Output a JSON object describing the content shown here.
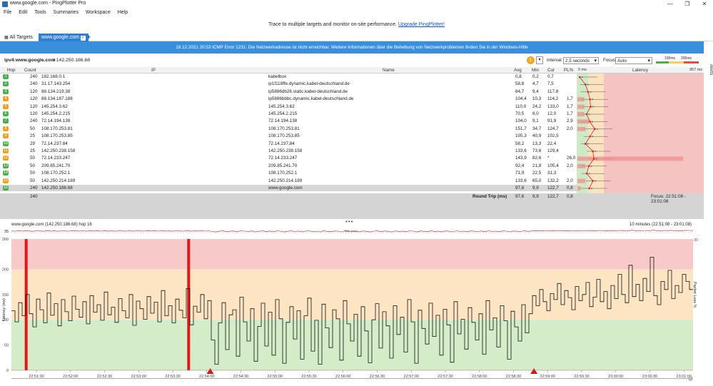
{
  "window": {
    "title": "www.google.com - PingPlotter Pro",
    "min": "—",
    "max": "❐",
    "close": "✕"
  },
  "menu": [
    "File",
    "Edit",
    "Tools",
    "Summaries",
    "Workspace",
    "Help"
  ],
  "banner": {
    "text": "Trace to multiple targets and monitor on-site performance.",
    "link": "Upgrade PingPlotter!"
  },
  "tabs": {
    "all_targets": "All Targets",
    "active": "www.google.com",
    "add": "+"
  },
  "error_bar": "18.12.2021 20:53 ICMP Error 1231: Die Netzwerkadresse ist nicht erreichbar. Weitere Informationen über die Behebung von Netzwerkproblemen finden Sie in der Windows-Hilfe",
  "alerts_label": "Alerts",
  "target": {
    "label": "ipv4:www.google.com",
    "ip": "/ 142.250.186.68"
  },
  "toolbar": {
    "interval_label": "Interval",
    "interval_value": "2,5 seconds",
    "focus_label": "Focus",
    "focus_value": "Auto",
    "scale_100": "100ms",
    "scale_200": "200ms"
  },
  "columns": {
    "hop": "Hop",
    "count": "Count",
    "ip": "IP",
    "name": "Name",
    "avg": "Avg",
    "min": "Min",
    "cur": "Cur",
    "pl": "PL%",
    "zero": "0 ms",
    "latency": "Latency",
    "max": "957 ms"
  },
  "hops": [
    {
      "hop": "1",
      "count": "240",
      "ip": "192.168.0.1",
      "name": "kabelbox",
      "avg": "0,8",
      "min": "0,2",
      "cur": "0,7",
      "pl": "",
      "color": "#4caf50"
    },
    {
      "hop": "2",
      "count": "240",
      "ip": "31.17.143.254",
      "name": "ip1f118ffe.dynamic.kabel-deutschland.de",
      "avg": "58,8",
      "min": "4,7",
      "cur": "7,5",
      "pl": "",
      "color": "#4caf50"
    },
    {
      "hop": "3",
      "count": "120",
      "ip": "88.134.219.38",
      "name": "ip5886db26.static.kabel-deutschland.de",
      "avg": "84,7",
      "min": "9,4",
      "cur": "117,8",
      "pl": "",
      "color": "#4caf50"
    },
    {
      "hop": "4",
      "count": "120",
      "ip": "88.134.187.188",
      "name": "ip5886bbbc.dynamic.kabel-deutschland.de",
      "avg": "104,4",
      "min": "10,3",
      "cur": "114,2",
      "pl": "1,7",
      "color": "#f0a020"
    },
    {
      "hop": "5",
      "count": "120",
      "ip": "145.254.3.62",
      "name": "145.254.3.62",
      "avg": "110,0",
      "min": "24,2",
      "cur": "133,0",
      "pl": "1,7",
      "color": "#f0a020"
    },
    {
      "hop": "6",
      "count": "120",
      "ip": "145.254.2.215",
      "name": "145.254.2.215",
      "avg": "70,5",
      "min": "8,0",
      "cur": "12,0",
      "pl": "1,7",
      "color": "#4caf50"
    },
    {
      "hop": "7",
      "count": "240",
      "ip": "72.14.194.138",
      "name": "72.14.194.138",
      "avg": "104,0",
      "min": "9,1",
      "cur": "91,9",
      "pl": "2,9",
      "color": "#4caf50"
    },
    {
      "hop": "8",
      "count": "50",
      "ip": "108.170.253.81",
      "name": "108.170.253.81",
      "avg": "151,7",
      "min": "34,7",
      "cur": "124,7",
      "pl": "2,0",
      "color": "#f0a020"
    },
    {
      "hop": "9",
      "count": "25",
      "ip": "108.170.253.85",
      "name": "108.170.253.85",
      "avg": "105,3",
      "min": "40,9",
      "cur": "102,5",
      "pl": "",
      "color": "#f0a020"
    },
    {
      "hop": "10",
      "count": "29",
      "ip": "72.14.237.84",
      "name": "72.14.237.84",
      "avg": "58,2",
      "min": "13,3",
      "cur": "22,4",
      "pl": "",
      "color": "#4caf50"
    },
    {
      "hop": "11",
      "count": "25",
      "ip": "142.250.238.158",
      "name": "142.250.238.158",
      "avg": "133,6",
      "min": "73,6",
      "cur": "129,4",
      "pl": "",
      "color": "#f0a020"
    },
    {
      "hop": "12",
      "count": "50",
      "ip": "72.14.233.247",
      "name": "72.14.233.247",
      "avg": "143,9",
      "min": "82,6",
      "cur": "*",
      "pl": "26,0",
      "color": "#f0a020"
    },
    {
      "hop": "13",
      "count": "50",
      "ip": "209.85.241.70",
      "name": "209.85.241.70",
      "avg": "92,4",
      "min": "21,8",
      "cur": "105,4",
      "pl": "2,0",
      "color": "#4caf50"
    },
    {
      "hop": "14",
      "count": "50",
      "ip": "108.170.252.1",
      "name": "108.170.252.1",
      "avg": "71,9",
      "min": "22,5",
      "cur": "31,3",
      "pl": "",
      "color": "#4caf50"
    },
    {
      "hop": "15",
      "count": "50",
      "ip": "142.250.214.189",
      "name": "142.250.214.189",
      "avg": "133,6",
      "min": "65,0",
      "cur": "132,2",
      "pl": "2,0",
      "color": "#f0a020"
    },
    {
      "hop": "16",
      "count": "240",
      "ip": "142.250.186.68",
      "name": "www.google.com",
      "avg": "97,6",
      "min": "9,9",
      "cur": "122,7",
      "pl": "0,8",
      "color": "#4caf50"
    }
  ],
  "summary": {
    "count": "240",
    "label": "Round Trip (ms)",
    "avg": "97,6",
    "min": "9,9",
    "cur": "122,7",
    "pl": "0,8",
    "focus": "Focus: 22:51:08 - 23:01:08"
  },
  "bottom": {
    "title": "www.google.com (142.250.186.68) hop 16",
    "range": "10 minutes (22:51:08 - 23:01:08)",
    "overview_max": "35",
    "jitter_label": "Jitter (ms)",
    "y_label": "Latency (ms)",
    "y2_label": "Packet Loss %",
    "y_ticks": [
      "260",
      "200",
      "150",
      "100",
      "50",
      "0"
    ],
    "y2_top": "30"
  },
  "chart_data": {
    "type": "line",
    "title": "www.google.com (142.250.186.68) hop 16",
    "ylabel": "Latency (ms)",
    "y2label": "Packet Loss %",
    "ylim": [
      0,
      260
    ],
    "x_ticks": [
      "22:51:30",
      "22:52:00",
      "22:52:30",
      "22:53:00",
      "22:53:30",
      "22:54:00",
      "22:54:30",
      "22:55:00",
      "22:55:30",
      "22:56:00",
      "22:56:30",
      "22:57:00",
      "22:57:30",
      "22:58:00",
      "22:58:30",
      "22:59:00",
      "22:59:30",
      "23:00:00",
      "23:00:30",
      "23:01:00"
    ],
    "packet_loss_at": [
      "22:51:21",
      "22:53:44"
    ],
    "markers_at": [
      "22:54:03",
      "22:58:48"
    ],
    "series": [
      {
        "values": [
          118,
          96,
          134,
          108,
          150,
          112,
          86,
          141,
          120,
          94,
          153,
          109,
          132,
          88,
          140,
          116,
          98,
          147,
          121,
          105,
          136,
          92,
          148,
          115,
          130,
          99,
          155,
          110,
          125,
          95,
          142,
          118,
          104,
          150,
          89,
          137,
          122,
          101,
          146,
          113,
          135,
          96,
          158,
          108,
          128,
          94,
          141,
          119,
          104,
          162,
          90,
          127,
          115,
          150,
          102,
          138,
          60,
          12,
          94,
          134,
          41,
          110,
          120,
          28,
          145,
          96,
          58,
          122,
          18,
          87,
          133,
          48,
          115,
          30,
          140,
          102,
          14,
          95,
          126,
          62,
          118,
          22,
          108,
          143,
          38,
          99,
          12,
          131,
          84,
          45,
          120,
          102,
          20,
          138,
          92,
          58,
          111,
          28,
          126,
          78,
          15,
          100,
          132,
          44,
          116,
          88,
          24,
          128,
          71,
          105,
          36,
          140,
          96,
          14,
          119,
          83,
          52,
          133,
          67,
          109,
          30,
          121,
          90,
          16,
          136,
          72,
          101,
          42,
          124,
          95,
          60,
          112,
          32,
          138,
          80,
          104,
          46,
          128,
          98,
          22,
          117,
          86,
          58,
          130,
          74,
          112,
          148,
          128,
          160,
          136,
          118,
          152,
          140,
          172,
          130,
          158,
          144,
          120,
          166,
          138,
          150,
          174,
          126,
          145,
          180,
          136,
          156,
          122,
          168,
          142,
          190,
          150,
          134,
          208,
          146,
          170,
          138,
          182,
          156,
          224,
          148,
          130,
          176,
          160,
          198,
          142,
          168,
          154,
          190,
          176,
          160
        ]
      }
    ]
  }
}
